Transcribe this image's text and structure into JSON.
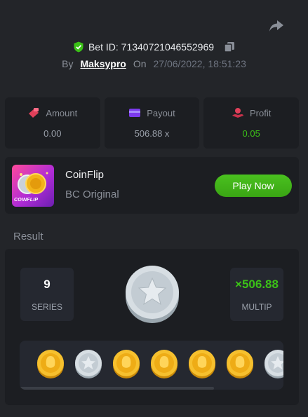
{
  "header": {
    "bet_id": "Bet ID: 7134072104655296­9",
    "by_label": "By",
    "username": "Maksypro",
    "on_label": "On",
    "datetime": "27/06/2022, 18:51:23"
  },
  "stats": [
    {
      "label": "Amount",
      "value": "0.00",
      "icon": "amount-icon",
      "color": "#e0405a"
    },
    {
      "label": "Payout",
      "value": "506.88 x",
      "icon": "payout-icon",
      "color": "#7c3aed"
    },
    {
      "label": "Profit",
      "value": "0.05",
      "icon": "profit-icon",
      "color": "#e0405a"
    }
  ],
  "game": {
    "thumb_label": "COINFLIP",
    "name": "CoinFlip",
    "subtitle": "BC Original",
    "play_label": "Play Now"
  },
  "result": {
    "title": "Result",
    "series_value": "9",
    "series_label": "SERIES",
    "multip_value": "×506.88",
    "multip_label": "MULTIP",
    "coins": [
      "gold",
      "silver",
      "gold",
      "gold",
      "gold",
      "gold",
      "silver"
    ]
  },
  "colors": {
    "accent_green": "#3bc117",
    "background": "#232529",
    "panel": "#1c1e22"
  }
}
